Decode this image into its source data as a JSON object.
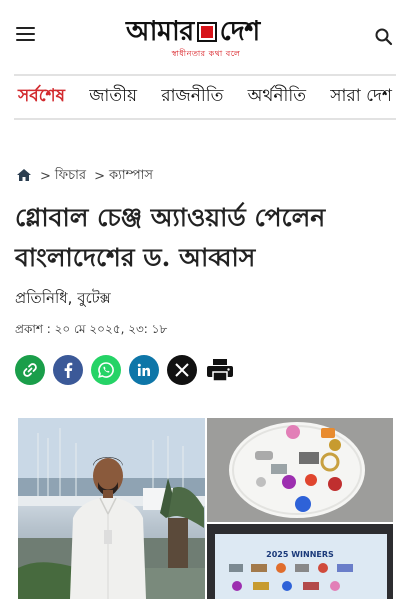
{
  "header": {
    "logo_left": "আমার",
    "logo_right": "দেশ",
    "logo_tagline": "স্বাধীনতার কথা বলে"
  },
  "nav": {
    "items": [
      "সর্বশেষ",
      "জাতীয়",
      "রাজনীতি",
      "অর্থনীতি",
      "সারা দেশ"
    ]
  },
  "breadcrumb": {
    "items": [
      "ফিচার",
      "ক্যাম্পাস"
    ]
  },
  "article": {
    "title_line1": "গ্লোবাল চেঞ্জ অ্যাওয়ার্ড পেলেন",
    "title_line2": "বাংলাদেশের ড. আব্বাস",
    "author": "প্রতিনিধি, বুটেক্স",
    "published": "প্রকাশ : ২০ মে ২০২৫, ২৩: ১৮"
  },
  "share": {
    "buttons": [
      {
        "name": "copy-link",
        "icon": "link-icon",
        "color": "#1a9e4a"
      },
      {
        "name": "facebook",
        "icon": "facebook-icon",
        "color": "#3b5998"
      },
      {
        "name": "whatsapp",
        "icon": "whatsapp-icon",
        "color": "#25d366"
      },
      {
        "name": "linkedin",
        "icon": "linkedin-icon",
        "color": "#0e76a8"
      },
      {
        "name": "x",
        "icon": "x-icon",
        "color": "#111111"
      },
      {
        "name": "print",
        "icon": "print-icon",
        "color": "#111111"
      }
    ]
  },
  "images": {
    "right_bottom_text": "2025 WINNERS"
  },
  "colors": {
    "accent": "#d22a2e",
    "logo_red": "#d7141a"
  }
}
